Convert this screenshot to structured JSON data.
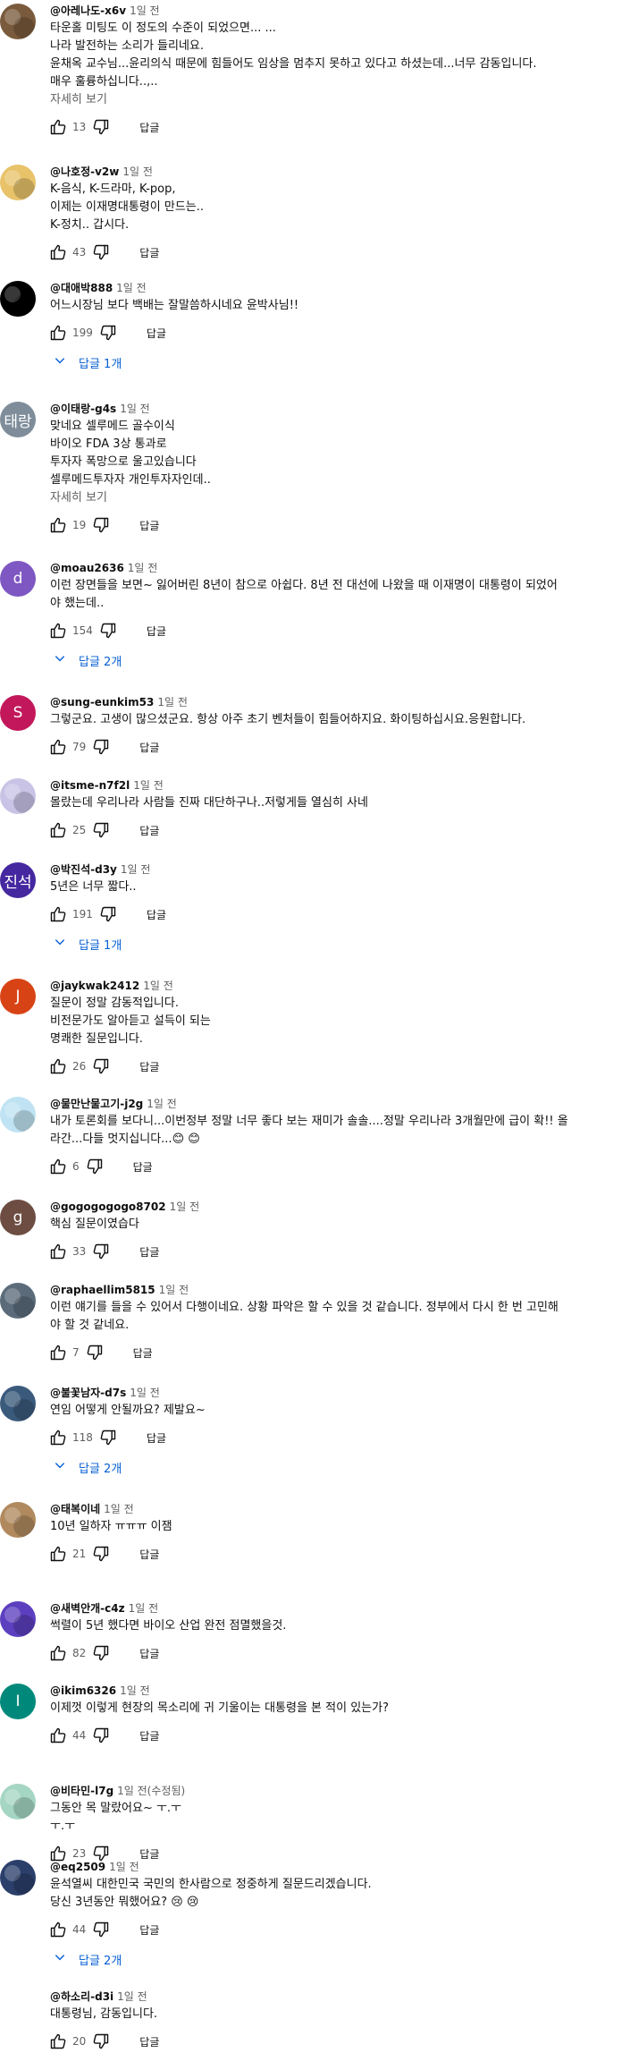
{
  "ui": {
    "reply_label": "답글"
  },
  "comments": [
    {
      "author": "@아레나도-x6v",
      "time": "1일 전",
      "avatar_letter": "",
      "avatar_color": "#7a5a3c",
      "text": [
        "타운홀 미팅도 이 정도의 수준이 되었으면... ...",
        "나라 발전하는 소리가 들리네요.",
        "윤채옥 교수님...윤리의식 때문에 힘들어도 임상을 멈추지 못하고 있다고 하셨는데...너무 감동입니다.",
        "매우 훌륭하십니다..,.."
      ],
      "more": "자세히 보기",
      "likes": "13",
      "replies": ""
    },
    {
      "author": "@나호정-v2w",
      "time": "1일 전",
      "avatar_letter": "",
      "avatar_color": "#e8c36a",
      "text": [
        "K-음식, K-드라마, K-pop,",
        "이제는 이재명대통령이 만드는..",
        "K-정치.. 갑시다."
      ],
      "more": "",
      "likes": "43",
      "replies": ""
    },
    {
      "author": "@대애박888",
      "time": "1일 전",
      "avatar_letter": "",
      "avatar_color": "#000000",
      "text": [
        "어느시장님 보다 백배는 잘말씀하시네요 윤박사님!!"
      ],
      "more": "",
      "likes": "199",
      "replies": "답글 1개"
    },
    {
      "author": "@이태랑-g4s",
      "time": "1일 전",
      "avatar_letter": "태랑",
      "avatar_color": "#7f8d9a",
      "text": [
        "맞네요 셀루메드 골수이식",
        "바이오 FDA 3상 통과로",
        "투자자 폭망으로 울고있습니다",
        "셀루메드투자자 개인투자자인데.."
      ],
      "more": "자세히 보기",
      "likes": "19",
      "replies": ""
    },
    {
      "author": "@moau2636",
      "time": "1일 전",
      "avatar_letter": "d",
      "avatar_color": "#7e57c2",
      "text": [
        "이런 장면들을 보면~ 잃어버린 8년이 참으로 아쉽다. 8년 전 대선에 나왔을 때 이재명이 대통령이 되었어",
        "야 했는데.."
      ],
      "more": "",
      "likes": "154",
      "replies": "답글 2개"
    },
    {
      "author": "@sung-eunkim53",
      "time": "1일 전",
      "avatar_letter": "S",
      "avatar_color": "#c2185b",
      "text": [
        "그렇군요. 고생이 많으셨군요. 항상 아주 초기 벤처들이 힘들어하지요. 화이팅하십시요.응원합니다."
      ],
      "more": "",
      "likes": "79",
      "replies": ""
    },
    {
      "author": "@itsme-n7f2l",
      "time": "1일 전",
      "avatar_letter": "",
      "avatar_color": "#c9c3e6",
      "text": [
        "몰랐는데 우리나라 사람들 진짜 대단하구나..저렇게들 열심히 사네"
      ],
      "more": "",
      "likes": "25",
      "replies": ""
    },
    {
      "author": "@박진석-d3y",
      "time": "1일 전",
      "avatar_letter": "진석",
      "avatar_color": "#4527a0",
      "text": [
        "5년은 너무 짧다.."
      ],
      "more": "",
      "likes": "191",
      "replies": "답글 1개"
    },
    {
      "author": "@jaykwak2412",
      "time": "1일 전",
      "avatar_letter": "J",
      "avatar_color": "#d84315",
      "text": [
        "질문이 정말 감동적입니다.",
        "비전문가도 알아듣고 설득이 되는",
        "명쾌한 질문입니다."
      ],
      "more": "",
      "likes": "26",
      "replies": ""
    },
    {
      "author": "@물만난물고기-j2g",
      "time": "1일 전",
      "avatar_letter": "",
      "avatar_color": "#bfe3f2",
      "text": [
        "내가 토론회를 보다니...이번정부 정말 너무 좋다 보는 재미가 솔솔....정말 우리나라 3개월만에 급이 확!! 올",
        "라간...다들 멋지십니다...😊 😊"
      ],
      "more": "",
      "likes": "6",
      "replies": ""
    },
    {
      "author": "@gogogogogo8702",
      "time": "1일 전",
      "avatar_letter": "g",
      "avatar_color": "#6d4c41",
      "text": [
        "핵심 질문이였습다"
      ],
      "more": "",
      "likes": "33",
      "replies": ""
    },
    {
      "author": "@raphaellim5815",
      "time": "1일 전",
      "avatar_letter": "",
      "avatar_color": "#5b6b7a",
      "text": [
        "이런 얘기를 들을 수 있어서 다행이네요. 상황 파악은 할 수 있을 것 같습니다. 정부에서 다시 한 번 고민해",
        "야 할 것 같네요."
      ],
      "more": "",
      "likes": "7",
      "replies": ""
    },
    {
      "author": "@불꽃남자-d7s",
      "time": "1일 전",
      "avatar_letter": "",
      "avatar_color": "#3a5a7c",
      "text": [
        "연임 어떻게 안될까요? 제발요~"
      ],
      "more": "",
      "likes": "118",
      "replies": "답글 2개"
    },
    {
      "author": "@태복이네",
      "time": "1일 전",
      "avatar_letter": "",
      "avatar_color": "#b08a5e",
      "text": [
        "10년 일하자 ㅠㅠㅠ 이잼"
      ],
      "more": "",
      "likes": "21",
      "replies": ""
    },
    {
      "author": "@새벽안개-c4z",
      "time": "1일 전",
      "avatar_letter": "",
      "avatar_color": "#5c3fbf",
      "text": [
        "썩렬이 5년 했다면 바이오 산업 완전 점멸했을것."
      ],
      "more": "",
      "likes": "82",
      "replies": ""
    },
    {
      "author": "@ikim6326",
      "time": "1일 전",
      "avatar_letter": "I",
      "avatar_color": "#00897b",
      "text": [
        "이제껏 이렇게 현장의 목소리에 귀 기울이는 대통령을 본 적이 있는가?"
      ],
      "more": "",
      "likes": "44",
      "replies": ""
    },
    {
      "author": "@비타민-l7g",
      "time": "1일 전(수정됨)",
      "avatar_letter": "",
      "avatar_color": "#a5d6c3",
      "text": [
        "그동안 목 말랐어요~ ㅜ.ㅜ",
        "ㅜ.ㅜ"
      ],
      "more": "",
      "likes": "23",
      "replies": ""
    },
    {
      "author": "@eq2509",
      "time": "1일 전",
      "avatar_letter": "",
      "avatar_color": "#2b3f6b",
      "text": [
        "윤석열씨 대한민국 국민의 한사람으로 정중하게 질문드리겠습니다.",
        "당신 3년동안 뭐했어요? 😢 😢"
      ],
      "more": "",
      "likes": "44",
      "replies": "답글 2개"
    },
    {
      "author": "@하소리-d3i",
      "time": "1일 전",
      "avatar_letter": "",
      "avatar_color": "",
      "text": [
        "대통령님, 감동입니다."
      ],
      "more": "",
      "likes": "20",
      "replies": ""
    }
  ]
}
